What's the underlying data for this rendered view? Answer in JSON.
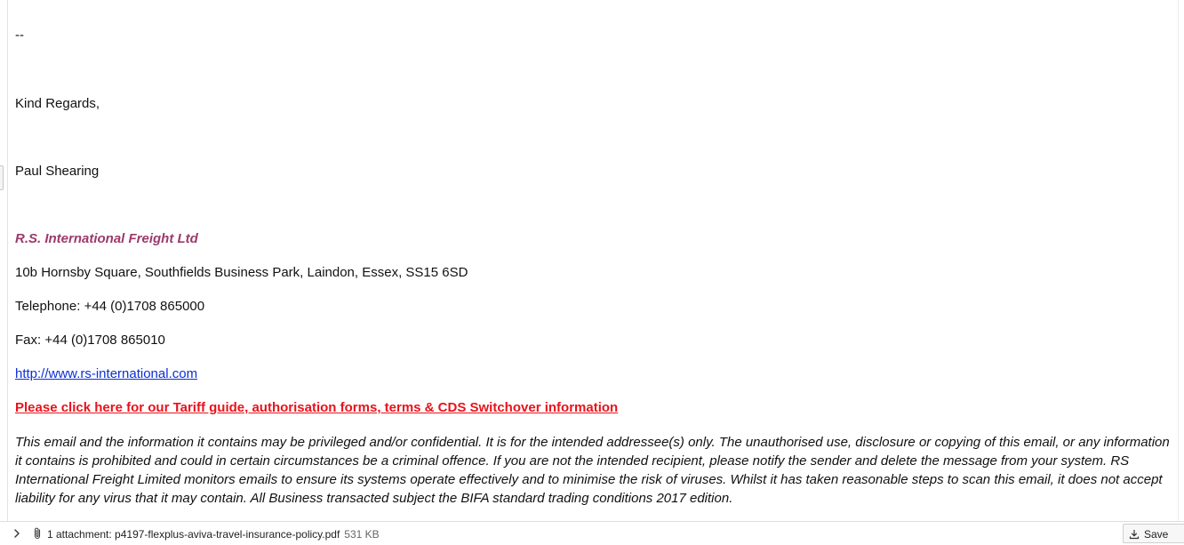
{
  "email_body": {
    "separator": "--",
    "closing": "Kind Regards,",
    "sender_name": "Paul Shearing",
    "company_name": "R.S. International Freight Ltd",
    "address": "10b Hornsby Square, Southfields Business Park, Laindon, Essex, SS15 6SD",
    "telephone": "Telephone: +44 (0)1708 865000",
    "fax": "Fax: +44 (0)1708 865010",
    "website_link": "http://www.rs-international.com",
    "promo_link": "Please click here for our Tariff guide, authorisation forms, terms & CDS Switchover information",
    "disclaimer": "This email and the information it contains may be privileged and/or confidential. It is for the intended addressee(s) only. The unauthorised use, disclosure or copying of this email, or any information it contains is prohibited and could in certain circumstances be a criminal offence. If you are not the intended recipient, please notify the sender and delete the message from your system. RS International Freight Limited monitors emails to ensure its systems operate effectively and to minimise the risk of viruses. Whilst it has taken reasonable steps to scan this email, it does not accept liability for any virus that it may contain. All Business transacted subject the BIFA standard trading conditions 2017 edition."
  },
  "attachment_bar": {
    "label": "1 attachment: p4197-flexplus-aviva-travel-insurance-policy.pdf",
    "size": "531 KB",
    "save_label": "Save",
    "toggle_icon": "chevron-right-icon",
    "attachment_icon": "paperclip-icon",
    "save_icon": "download-icon"
  },
  "colors": {
    "company": "#9b3a6b",
    "link": "#0b2fd6",
    "promo": "#e8121b"
  }
}
